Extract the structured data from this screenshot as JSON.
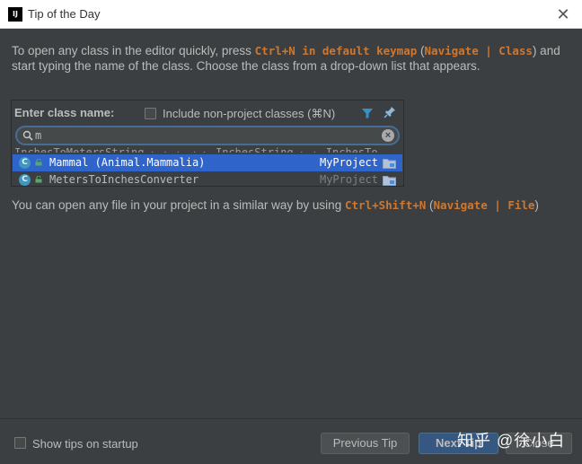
{
  "window": {
    "title": "Tip of the Day",
    "close_glyph": "✕"
  },
  "tip1": {
    "text_a": "To open any class in the editor quickly, press ",
    "kbd": "Ctrl+N in default keymap",
    "text_b": " (",
    "nav": "Navigate | Class",
    "text_c": ") and start typing the name of the class. Choose the class from a drop-down list that appears."
  },
  "popup": {
    "header": "Enter class name:",
    "include_label": "Include non-project classes (⌘N)",
    "include_checked": false,
    "search_value": "m",
    "ghost_text": "InchesToMetersString ← ← ← → ← InchesString ← ← InchesTo",
    "results": [
      {
        "icon_letter": "C",
        "name": "Mammal (Animal.Mammalia)",
        "project": "MyProject",
        "selected": true
      },
      {
        "icon_letter": "C",
        "name": "MetersToInchesConverter",
        "project": "MyProject",
        "selected": false
      }
    ]
  },
  "tip2": {
    "text_a": "You can open any file in your project in a similar way by using ",
    "kbd": "Ctrl+Shift+N",
    "text_b": " (",
    "nav": "Navigate | File",
    "text_c": ")"
  },
  "footer": {
    "show_tips_label": "Show tips on startup",
    "show_tips_checked": false,
    "prev_label": "Previous Tip",
    "next_label": "Next Tip",
    "close_label": "Close",
    "watermark": "知乎 @徐小白"
  },
  "colors": {
    "background": "#3c3f41",
    "keyword": "#cc7832",
    "selection": "#2f65ca",
    "focus": "#466d94"
  }
}
